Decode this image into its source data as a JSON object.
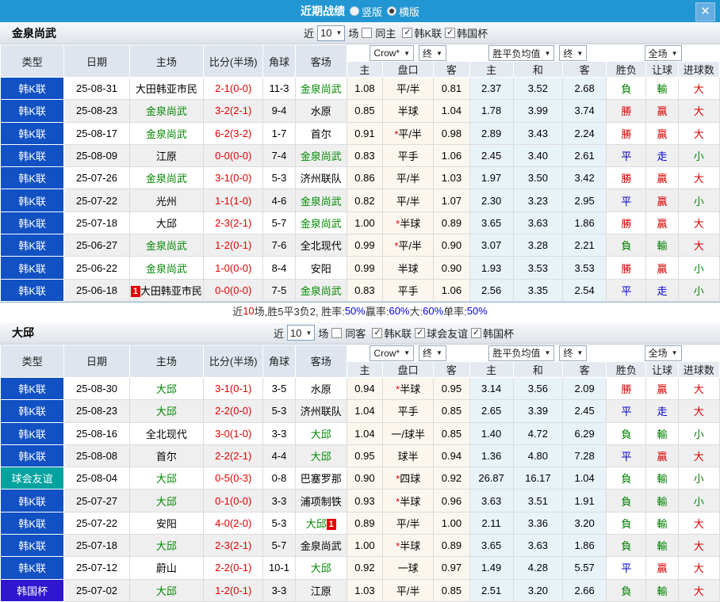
{
  "titlebar": {
    "title": "近期战绩",
    "radio_vertical": "竖版",
    "radio_horizontal": "横版",
    "horizontal_selected": true,
    "close_glyph": "✕"
  },
  "table_header": {
    "main": [
      "类型",
      "日期",
      "主场",
      "比分(半场)",
      "角球",
      "客场"
    ],
    "sub": [
      "主",
      "盘口",
      "客",
      "主",
      "和",
      "客",
      "胜负",
      "让球",
      "进球数"
    ],
    "odds_source_select": "Crow*",
    "odds_final_select": "终",
    "avg_select": "胜平负均值",
    "avg_final_select": "终",
    "fullmatch_select": "全场",
    "arrow": "▼"
  },
  "type_colors": {
    "韩K联": "#1151c3",
    "球会友谊": "#00a2a0",
    "韩国杯": "#2f16cf"
  },
  "result_colors": {
    "r": "#d90000",
    "g": "#008000",
    "b": "#0000cc"
  },
  "sections": [
    {
      "team": "金泉尚武",
      "controls": {
        "near": "近",
        "count": "10",
        "games": "场",
        "same": {
          "label": "同主",
          "checked": false
        },
        "leagues": [
          {
            "label": "韩K联",
            "checked": true
          },
          {
            "label": "韩国杯",
            "checked": true
          }
        ]
      },
      "rows": [
        {
          "type": "韩K联",
          "date": "25-08-31",
          "home": "大田韩亚市民",
          "home_green": false,
          "home_badge": false,
          "score": "2-1",
          "half": "(0-0)",
          "corner": "11-3",
          "away": "金泉尚武",
          "away_green": true,
          "away_badge": false,
          "o1": "1.08",
          "star": false,
          "line": "平/半",
          "o2": "0.81",
          "a1": "2.37",
          "a2": "3.52",
          "a3": "2.68",
          "r1": "負",
          "r1c": "g",
          "r2": "輸",
          "r2c": "g",
          "r3": "大",
          "r3c": "r"
        },
        {
          "type": "韩K联",
          "date": "25-08-23",
          "home": "金泉尚武",
          "home_green": true,
          "home_badge": false,
          "score": "3-2",
          "half": "(2-1)",
          "corner": "9-4",
          "away": "水原",
          "away_green": false,
          "away_badge": false,
          "o1": "0.85",
          "star": false,
          "line": "半球",
          "o2": "1.04",
          "a1": "1.78",
          "a2": "3.99",
          "a3": "3.74",
          "r1": "勝",
          "r1c": "r",
          "r2": "贏",
          "r2c": "r",
          "r3": "大",
          "r3c": "r"
        },
        {
          "type": "韩K联",
          "date": "25-08-17",
          "home": "金泉尚武",
          "home_green": true,
          "home_badge": false,
          "score": "6-2",
          "half": "(3-2)",
          "corner": "1-7",
          "away": "首尔",
          "away_green": false,
          "away_badge": false,
          "o1": "0.91",
          "star": true,
          "line": "平/半",
          "o2": "0.98",
          "a1": "2.89",
          "a2": "3.43",
          "a3": "2.24",
          "r1": "勝",
          "r1c": "r",
          "r2": "贏",
          "r2c": "r",
          "r3": "大",
          "r3c": "r"
        },
        {
          "type": "韩K联",
          "date": "25-08-09",
          "home": "江原",
          "home_green": false,
          "home_badge": false,
          "score": "0-0",
          "half": "(0-0)",
          "corner": "7-4",
          "away": "金泉尚武",
          "away_green": true,
          "away_badge": false,
          "o1": "0.83",
          "star": false,
          "line": "平手",
          "o2": "1.06",
          "a1": "2.45",
          "a2": "3.40",
          "a3": "2.61",
          "r1": "平",
          "r1c": "b",
          "r2": "走",
          "r2c": "b",
          "r3": "小",
          "r3c": "g"
        },
        {
          "type": "韩K联",
          "date": "25-07-26",
          "home": "金泉尚武",
          "home_green": true,
          "home_badge": false,
          "score": "3-1",
          "half": "(0-0)",
          "corner": "5-3",
          "away": "济州联队",
          "away_green": false,
          "away_badge": false,
          "o1": "0.86",
          "star": false,
          "line": "平/半",
          "o2": "1.03",
          "a1": "1.97",
          "a2": "3.50",
          "a3": "3.42",
          "r1": "勝",
          "r1c": "r",
          "r2": "贏",
          "r2c": "r",
          "r3": "大",
          "r3c": "r"
        },
        {
          "type": "韩K联",
          "date": "25-07-22",
          "home": "光州",
          "home_green": false,
          "home_badge": false,
          "score": "1-1",
          "half": "(1-0)",
          "corner": "4-6",
          "away": "金泉尚武",
          "away_green": true,
          "away_badge": false,
          "o1": "0.82",
          "star": false,
          "line": "平/半",
          "o2": "1.07",
          "a1": "2.30",
          "a2": "3.23",
          "a3": "2.95",
          "r1": "平",
          "r1c": "b",
          "r2": "贏",
          "r2c": "r",
          "r3": "小",
          "r3c": "g"
        },
        {
          "type": "韩K联",
          "date": "25-07-18",
          "home": "大邱",
          "home_green": false,
          "home_badge": false,
          "score": "2-3",
          "half": "(2-1)",
          "corner": "5-7",
          "away": "金泉尚武",
          "away_green": true,
          "away_badge": false,
          "o1": "1.00",
          "star": true,
          "line": "半球",
          "o2": "0.89",
          "a1": "3.65",
          "a2": "3.63",
          "a3": "1.86",
          "r1": "勝",
          "r1c": "r",
          "r2": "贏",
          "r2c": "r",
          "r3": "大",
          "r3c": "r"
        },
        {
          "type": "韩K联",
          "date": "25-06-27",
          "home": "金泉尚武",
          "home_green": true,
          "home_badge": false,
          "score": "1-2",
          "half": "(0-1)",
          "corner": "7-6",
          "away": "全北现代",
          "away_green": false,
          "away_badge": false,
          "o1": "0.99",
          "star": true,
          "line": "平/半",
          "o2": "0.90",
          "a1": "3.07",
          "a2": "3.28",
          "a3": "2.21",
          "r1": "負",
          "r1c": "g",
          "r2": "輸",
          "r2c": "g",
          "r3": "大",
          "r3c": "r"
        },
        {
          "type": "韩K联",
          "date": "25-06-22",
          "home": "金泉尚武",
          "home_green": true,
          "home_badge": false,
          "score": "1-0",
          "half": "(0-0)",
          "corner": "8-4",
          "away": "安阳",
          "away_green": false,
          "away_badge": false,
          "o1": "0.99",
          "star": false,
          "line": "半球",
          "o2": "0.90",
          "a1": "1.93",
          "a2": "3.53",
          "a3": "3.53",
          "r1": "勝",
          "r1c": "r",
          "r2": "贏",
          "r2c": "r",
          "r3": "小",
          "r3c": "g"
        },
        {
          "type": "韩K联",
          "date": "25-06-18",
          "home": "大田韩亚市民",
          "home_green": false,
          "home_badge": true,
          "score": "0-0",
          "half": "(0-0)",
          "corner": "7-5",
          "away": "金泉尚武",
          "away_green": true,
          "away_badge": false,
          "o1": "0.83",
          "star": false,
          "line": "平手",
          "o2": "1.06",
          "a1": "2.56",
          "a2": "3.35",
          "a3": "2.54",
          "r1": "平",
          "r1c": "b",
          "r2": "走",
          "r2c": "b",
          "r3": "小",
          "r3c": "g"
        }
      ],
      "summary": [
        {
          "t": "近",
          "c": "#333333"
        },
        {
          "t": "10",
          "c": "#e60000"
        },
        {
          "t": "场,胜5平3负2, 胜率:",
          "c": "#333333"
        },
        {
          "t": "50%",
          "c": "#0000ee"
        },
        {
          "t": " 赢率:",
          "c": "#333333"
        },
        {
          "t": "60%",
          "c": "#0000ee"
        },
        {
          "t": " 大:",
          "c": "#333333"
        },
        {
          "t": "60%",
          "c": "#0000ee"
        },
        {
          "t": " 单率:",
          "c": "#333333"
        },
        {
          "t": "50%",
          "c": "#0000ee"
        }
      ]
    },
    {
      "team": "大邱",
      "controls": {
        "near": "近",
        "count": "10",
        "games": "场",
        "same": {
          "label": "同客",
          "checked": false
        },
        "leagues": [
          {
            "label": "韩K联",
            "checked": true
          },
          {
            "label": "球会友谊",
            "checked": true
          },
          {
            "label": "韩国杯",
            "checked": true
          }
        ]
      },
      "rows": [
        {
          "type": "韩K联",
          "date": "25-08-30",
          "home": "大邱",
          "home_green": true,
          "home_badge": false,
          "score": "3-1",
          "half": "(0-1)",
          "corner": "3-5",
          "away": "水原",
          "away_green": false,
          "away_badge": false,
          "o1": "0.94",
          "star": true,
          "line": "半球",
          "o2": "0.95",
          "a1": "3.14",
          "a2": "3.56",
          "a3": "2.09",
          "r1": "勝",
          "r1c": "r",
          "r2": "贏",
          "r2c": "r",
          "r3": "大",
          "r3c": "r"
        },
        {
          "type": "韩K联",
          "date": "25-08-23",
          "home": "大邱",
          "home_green": true,
          "home_badge": false,
          "score": "2-2",
          "half": "(0-0)",
          "corner": "5-3",
          "away": "济州联队",
          "away_green": false,
          "away_badge": false,
          "o1": "1.04",
          "star": false,
          "line": "平手",
          "o2": "0.85",
          "a1": "2.65",
          "a2": "3.39",
          "a3": "2.45",
          "r1": "平",
          "r1c": "b",
          "r2": "走",
          "r2c": "b",
          "r3": "大",
          "r3c": "r"
        },
        {
          "type": "韩K联",
          "date": "25-08-16",
          "home": "全北现代",
          "home_green": false,
          "home_badge": false,
          "score": "3-0",
          "half": "(1-0)",
          "corner": "3-3",
          "away": "大邱",
          "away_green": true,
          "away_badge": false,
          "o1": "1.04",
          "star": false,
          "line": "一/球半",
          "o2": "0.85",
          "a1": "1.40",
          "a2": "4.72",
          "a3": "6.29",
          "r1": "負",
          "r1c": "g",
          "r2": "輸",
          "r2c": "g",
          "r3": "小",
          "r3c": "g"
        },
        {
          "type": "韩K联",
          "date": "25-08-08",
          "home": "首尔",
          "home_green": false,
          "home_badge": false,
          "score": "2-2",
          "half": "(2-1)",
          "corner": "4-4",
          "away": "大邱",
          "away_green": true,
          "away_badge": false,
          "o1": "0.95",
          "star": false,
          "line": "球半",
          "o2": "0.94",
          "a1": "1.36",
          "a2": "4.80",
          "a3": "7.28",
          "r1": "平",
          "r1c": "b",
          "r2": "贏",
          "r2c": "r",
          "r3": "大",
          "r3c": "r"
        },
        {
          "type": "球会友谊",
          "date": "25-08-04",
          "home": "大邱",
          "home_green": true,
          "home_badge": false,
          "score": "0-5",
          "half": "(0-3)",
          "corner": "0-8",
          "away": "巴塞罗那",
          "away_green": false,
          "away_badge": false,
          "o1": "0.90",
          "star": true,
          "line": "四球",
          "o2": "0.92",
          "a1": "26.87",
          "a2": "16.17",
          "a3": "1.04",
          "r1": "負",
          "r1c": "g",
          "r2": "輸",
          "r2c": "g",
          "r3": "小",
          "r3c": "g"
        },
        {
          "type": "韩K联",
          "date": "25-07-27",
          "home": "大邱",
          "home_green": true,
          "home_badge": false,
          "score": "0-1",
          "half": "(0-0)",
          "corner": "3-3",
          "away": "浦项制铁",
          "away_green": false,
          "away_badge": false,
          "o1": "0.93",
          "star": true,
          "line": "半球",
          "o2": "0.96",
          "a1": "3.63",
          "a2": "3.51",
          "a3": "1.91",
          "r1": "負",
          "r1c": "g",
          "r2": "輸",
          "r2c": "g",
          "r3": "小",
          "r3c": "g"
        },
        {
          "type": "韩K联",
          "date": "25-07-22",
          "home": "安阳",
          "home_green": false,
          "home_badge": false,
          "score": "4-0",
          "half": "(2-0)",
          "corner": "5-3",
          "away": "大邱",
          "away_green": true,
          "away_badge": true,
          "o1": "0.89",
          "star": false,
          "line": "平/半",
          "o2": "1.00",
          "a1": "2.11",
          "a2": "3.36",
          "a3": "3.20",
          "r1": "負",
          "r1c": "g",
          "r2": "輸",
          "r2c": "g",
          "r3": "大",
          "r3c": "r"
        },
        {
          "type": "韩K联",
          "date": "25-07-18",
          "home": "大邱",
          "home_green": true,
          "home_badge": false,
          "score": "2-3",
          "half": "(2-1)",
          "corner": "5-7",
          "away": "金泉尚武",
          "away_green": false,
          "away_badge": false,
          "o1": "1.00",
          "star": true,
          "line": "半球",
          "o2": "0.89",
          "a1": "3.65",
          "a2": "3.63",
          "a3": "1.86",
          "r1": "負",
          "r1c": "g",
          "r2": "輸",
          "r2c": "g",
          "r3": "大",
          "r3c": "r"
        },
        {
          "type": "韩K联",
          "date": "25-07-12",
          "home": "蔚山",
          "home_green": false,
          "home_badge": false,
          "score": "2-2",
          "half": "(0-1)",
          "corner": "10-1",
          "away": "大邱",
          "away_green": true,
          "away_badge": false,
          "o1": "0.92",
          "star": false,
          "line": "一球",
          "o2": "0.97",
          "a1": "1.49",
          "a2": "4.28",
          "a3": "5.57",
          "r1": "平",
          "r1c": "b",
          "r2": "贏",
          "r2c": "r",
          "r3": "大",
          "r3c": "r"
        },
        {
          "type": "韩国杯",
          "date": "25-07-02",
          "home": "大邱",
          "home_green": true,
          "home_badge": false,
          "score": "1-2",
          "half": "(0-1)",
          "corner": "3-3",
          "away": "江原",
          "away_green": false,
          "away_badge": false,
          "o1": "1.03",
          "star": false,
          "line": "平/半",
          "o2": "0.85",
          "a1": "2.51",
          "a2": "3.20",
          "a3": "2.66",
          "r1": "負",
          "r1c": "g",
          "r2": "輸",
          "r2c": "g",
          "r3": "大",
          "r3c": "r"
        }
      ],
      "summary": null
    }
  ]
}
